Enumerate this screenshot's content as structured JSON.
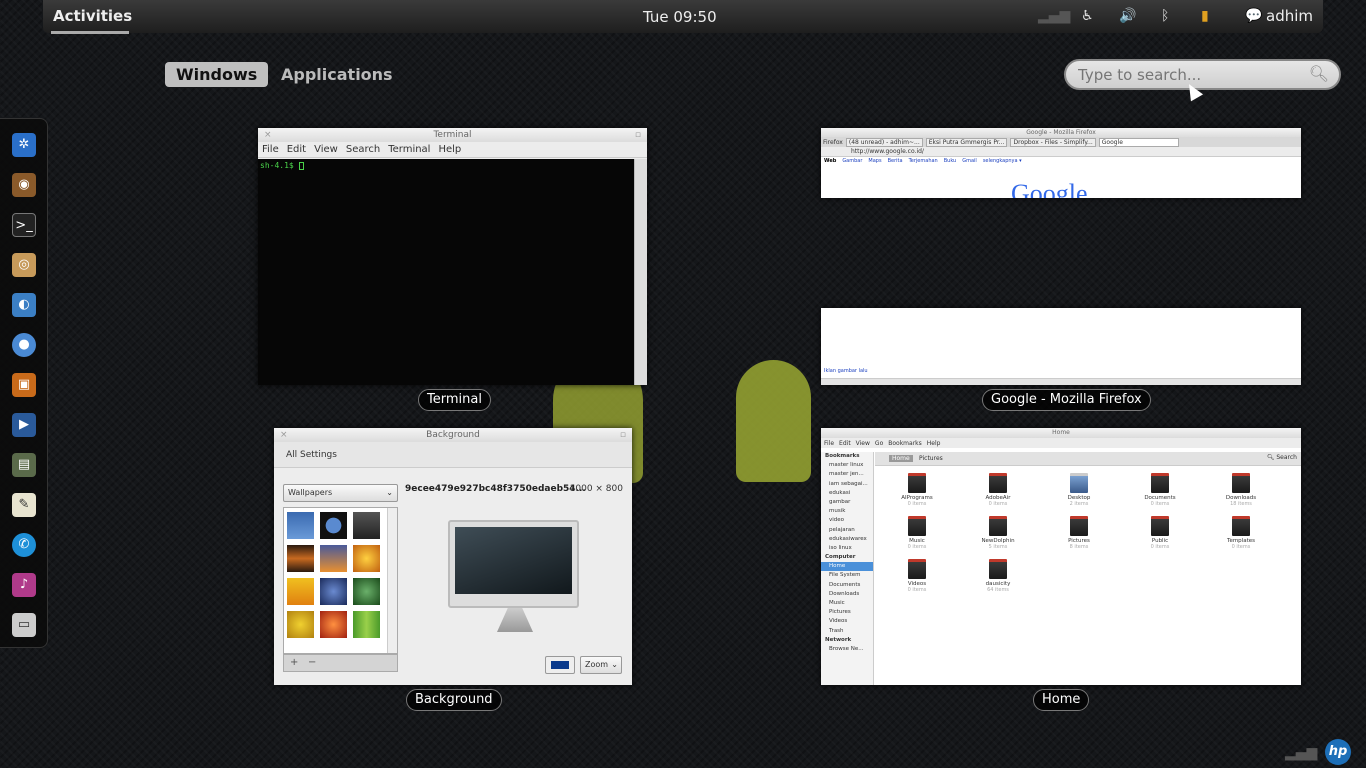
{
  "top_panel": {
    "activities": "Activities",
    "clock": "Tue 09:50",
    "username": "adhim"
  },
  "view_selector": {
    "windows": "Windows",
    "applications": "Applications"
  },
  "search": {
    "placeholder": "Type to search..."
  },
  "dash": {
    "items": [
      "settings-icon",
      "speaker-icon",
      "terminal-icon",
      "cheese-icon",
      "browser-icon",
      "chromium-icon",
      "camera-icon",
      "video-icon",
      "monitor-icon",
      "text-editor-icon",
      "chat-icon",
      "music-icon",
      "screenshot-icon"
    ]
  },
  "windows": {
    "terminal": {
      "title": "Terminal",
      "label": "Terminal",
      "menu": [
        "File",
        "Edit",
        "View",
        "Search",
        "Terminal",
        "Help"
      ],
      "prompt": "sh-4.1$"
    },
    "firefox": {
      "title": "Google - Mozilla Firefox",
      "label": "Google - Mozilla Firefox",
      "tabs": [
        "Firefox",
        "(48 unread) - adhim~...",
        "Eksi Putra Gmmergis Pr...",
        "Dropbox - Files - Simplify...",
        "Google"
      ],
      "url": "http://www.google.co.id/",
      "links": [
        "Web",
        "Gambar",
        "Maps",
        "Berita",
        "Terjemahan",
        "Buku",
        "Gmail",
        "selengkapnya ▾"
      ],
      "logo": "Google",
      "footer_link": "Iklan  gambar  lalu"
    },
    "background": {
      "title": "Background",
      "label": "Background",
      "toolbar": "All Settings",
      "select": "Wallpapers",
      "filename": "9ecee479e927bc48f3750edaeb54...",
      "size": "1000 × 800",
      "zoom": "Zoom",
      "add": "+",
      "remove": "−"
    },
    "home": {
      "title": "Home",
      "label": "Home",
      "menu": [
        "File",
        "Edit",
        "View",
        "Go",
        "Bookmarks",
        "Help"
      ],
      "path_home": "Home",
      "path_pictures": "Pictures",
      "search": "Search",
      "sidebar": [
        {
          "text": "Bookmarks",
          "hdr": true
        },
        {
          "text": "master linux"
        },
        {
          "text": "master jen..."
        },
        {
          "text": "iam sebagai..."
        },
        {
          "text": "edukasi"
        },
        {
          "text": "gambar"
        },
        {
          "text": "musik"
        },
        {
          "text": "video"
        },
        {
          "text": "pelajaran"
        },
        {
          "text": "edukasiwarex"
        },
        {
          "text": "iso linux"
        },
        {
          "text": "Computer",
          "hdr": true
        },
        {
          "text": "Home",
          "sel": true
        },
        {
          "text": "File System"
        },
        {
          "text": "Documents"
        },
        {
          "text": "Downloads"
        },
        {
          "text": "Music"
        },
        {
          "text": "Pictures"
        },
        {
          "text": "Videos"
        },
        {
          "text": "Trash"
        },
        {
          "text": "Network",
          "hdr": true
        },
        {
          "text": "Browse Ne..."
        }
      ],
      "files": [
        {
          "name": "AIPrograms",
          "sub": "0 items"
        },
        {
          "name": "AdobeAir",
          "sub": "0 items"
        },
        {
          "name": "Desktop",
          "sub": "2 items"
        },
        {
          "name": "Documents",
          "sub": "0 items"
        },
        {
          "name": "Downloads",
          "sub": "18 items"
        },
        {
          "name": "Music",
          "sub": "0 items"
        },
        {
          "name": "NewDolphin",
          "sub": "5 items"
        },
        {
          "name": "Pictures",
          "sub": "8 items"
        },
        {
          "name": "Public",
          "sub": "0 items"
        },
        {
          "name": "Templates",
          "sub": "0 items"
        },
        {
          "name": "Videos",
          "sub": "0 items"
        },
        {
          "name": "dausicity",
          "sub": "64 items"
        }
      ]
    }
  },
  "brand": {
    "hp": "hp"
  }
}
